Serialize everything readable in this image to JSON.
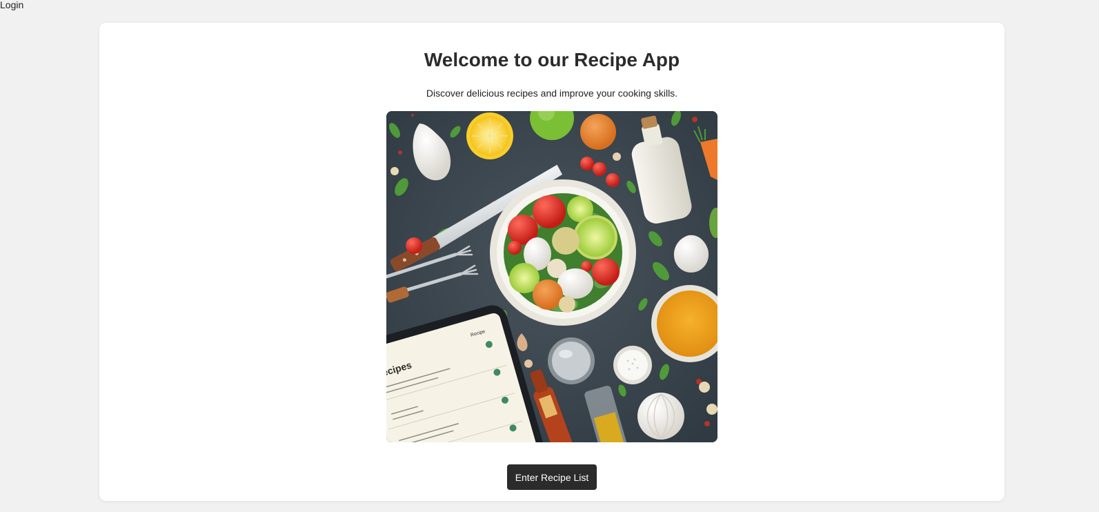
{
  "header": {
    "login_label": "Login"
  },
  "main": {
    "title": "Welcome to our Recipe App",
    "subtitle": "Discover delicious recipes and improve your cooking skills.",
    "hero_image_icon": "recipe-hero-illustration",
    "enter_button_label": "Enter Recipe List"
  },
  "hero_tablet": {
    "heading": "Recipes",
    "tab": "Recipe"
  },
  "colors": {
    "page_background": "#f1f1f1",
    "card_background": "#ffffff",
    "button_background": "#2b2b2b",
    "button_text": "#ffffff",
    "title_text": "#2b2b2b"
  }
}
